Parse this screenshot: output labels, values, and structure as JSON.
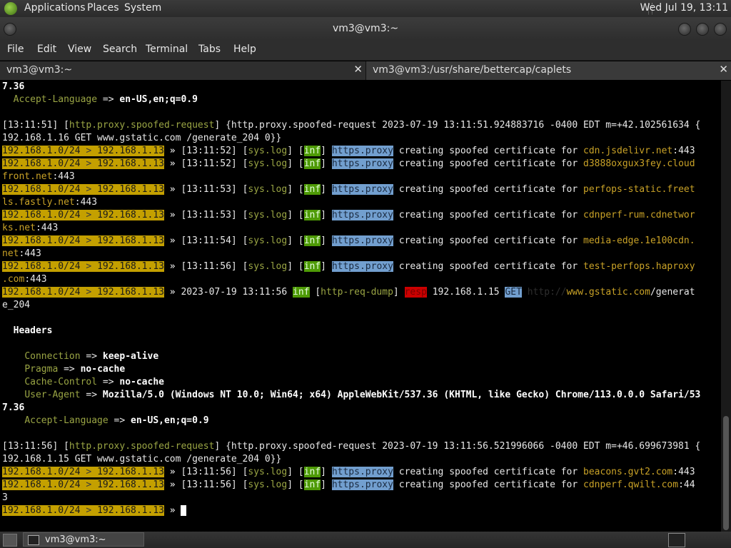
{
  "top_panel": {
    "menus": [
      "Applications",
      "Places",
      "System"
    ],
    "clock": "Wed Jul 19, 13:11"
  },
  "window": {
    "title": "vm3@vm3:~"
  },
  "menubar": [
    "File",
    "Edit",
    "View",
    "Search",
    "Terminal",
    "Tabs",
    "Help"
  ],
  "tabs": [
    {
      "label": "vm3@vm3:~",
      "close": "✕"
    },
    {
      "label": "vm3@vm3:/usr/share/bettercap/caplets",
      "close": "✕"
    }
  ],
  "prompt": {
    "net": "192.168.1.0/24",
    "sep": " > ",
    "ip": "192.168.1.13",
    "arrow": " » "
  },
  "terminal": {
    "l0": "7.36",
    "accept1": {
      "k": "Accept-Language",
      "op": " => ",
      "v": "en-US,en;q=0.9"
    },
    "spoof1_a": "[13:11:51] [",
    "spoof1_tag": "http.proxy.spoofed-request",
    "spoof1_b": "] {http.proxy.spoofed-request 2023-07-19 13:11:51.924883716 -0400 EDT m=+42.102561634 {",
    "spoof1_c": "192.168.1.16 GET www.gstatic.com /generate_204 0}}",
    "sys_open": "[",
    "sys_tag": "sys.log",
    "sys_close": "] [",
    "inf": "inf",
    "bracket_close": "]",
    "proxy": "https.proxy",
    "creating": " creating spoofed certificate for ",
    "times": [
      "[13:11:52]",
      "[13:11:52]",
      "[13:11:53]",
      "[13:11:53]",
      "[13:11:54]",
      "[13:11:56]"
    ],
    "certs": [
      {
        "host": "cdn.jsdelivr.net",
        "port": ":443",
        "wrap": ""
      },
      {
        "host": "d3888oxgux3fey.cloud",
        "port": "",
        "wrap_host": "front.net",
        "wrap_port": ":443"
      },
      {
        "host": "perfops-static.freet",
        "port": "",
        "wrap_host": "ls.fastly.net",
        "wrap_port": ":443"
      },
      {
        "host": "cdnperf-rum.cdnetwor",
        "port": "",
        "wrap_host": "ks.net",
        "wrap_port": ":443"
      },
      {
        "host": "media-edge.1e100cdn.",
        "port": "",
        "wrap_host": "net",
        "wrap_port": ":443"
      },
      {
        "host": "test-perfops.haproxy",
        "port": "",
        "wrap_host": ".com",
        "wrap_port": ":443"
      }
    ],
    "dump": {
      "date": "2023-07-19 13:11:56 ",
      "inf": "inf",
      "mod_open": " [",
      "mod": "http-req-dump",
      "mod_close": "] ",
      "resp": "resp",
      "ip": " 192.168.1.15 ",
      "get": "GET",
      "scheme": " http://",
      "domain": "www.gstatic.com",
      "path": "/generat",
      "wrap": "e_204"
    },
    "headers_title": "Headers",
    "h_connection": {
      "k": "Connection",
      "op": " => ",
      "v": "keep-alive"
    },
    "h_pragma": {
      "k": "Pragma",
      "op": " => ",
      "v": "no-cache"
    },
    "h_cache": {
      "k": "Cache-Control",
      "op": " => ",
      "v": "no-cache"
    },
    "h_ua": {
      "k": "User-Agent",
      "op": " => ",
      "v": "Mozilla/5.0 (Windows NT 10.0; Win64; x64) AppleWebKit/537.36 (KHTML, like Gecko) Chrome/113.0.0.0 Safari/53"
    },
    "ua_wrap": "7.36",
    "accept2": {
      "k": "Accept-Language",
      "op": " => ",
      "v": "en-US,en;q=0.9"
    },
    "spoof2_a": "[13:11:56] [",
    "spoof2_tag": "http.proxy.spoofed-request",
    "spoof2_b": "] {http.proxy.spoofed-request 2023-07-19 13:11:56.521996066 -0400 EDT m=+46.699673981 {",
    "spoof2_c": "192.168.1.15 GET www.gstatic.com /generate_204 0}}",
    "times2": [
      "[13:11:56]",
      "[13:11:56]"
    ],
    "certs2": [
      {
        "host": "beacons.gvt2.com",
        "port": ":443"
      },
      {
        "host": "cdnperf.qwilt.com",
        "port": ":44",
        "wrap": "3"
      }
    ]
  },
  "taskbar": {
    "window_label": "vm3@vm3:~"
  }
}
